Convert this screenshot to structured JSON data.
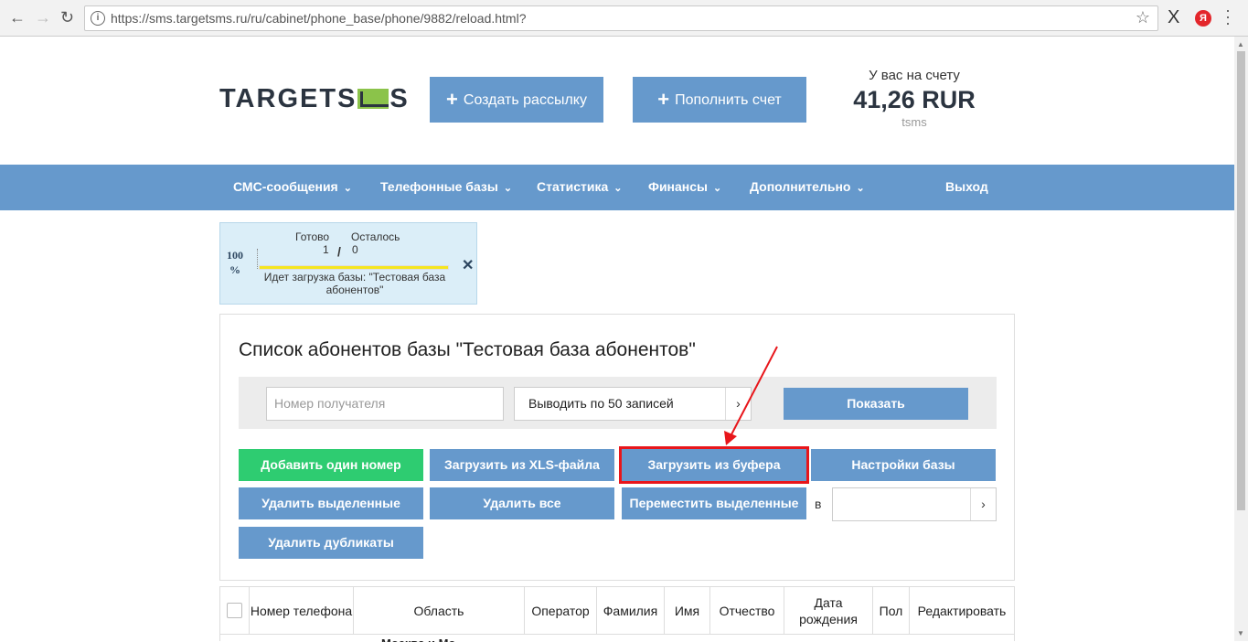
{
  "browser": {
    "url": "https://sms.targetsms.ru/ru/cabinet/phone_base/phone/9882/reload.html?",
    "ext_x": "X",
    "ext_ya": "Я"
  },
  "header": {
    "logo_left": "TARGETS",
    "logo_right": "S",
    "create_label": "Создать рассылку",
    "topup_label": "Пополнить счет",
    "balance_label": "У вас на счету",
    "balance_amount": "41,26 RUR",
    "balance_account": "tsms"
  },
  "nav": {
    "items": [
      {
        "label": "СМС-сообщения"
      },
      {
        "label": "Телефонные базы"
      },
      {
        "label": "Статистика"
      },
      {
        "label": "Финансы"
      },
      {
        "label": "Дополнительно"
      }
    ],
    "logout": "Выход"
  },
  "progress": {
    "percent_text": "100",
    "percent_sign": "%",
    "done_label": "Готово",
    "left_label": "Осталось",
    "done_value": "1",
    "left_value": "0",
    "percent": 100,
    "message": "Идет загрузка базы: \"Тестовая база абонентов\""
  },
  "main": {
    "title": "Список абонентов базы \"Тестовая база абонентов\"",
    "phone_placeholder": "Номер получателя",
    "per_page": "Выводить по 50 записей",
    "show_label": "Показать",
    "buttons": {
      "add_one": "Добавить один номер",
      "load_xls": "Загрузить из XLS-файла",
      "load_buffer": "Загрузить из буфера",
      "base_settings": "Настройки базы",
      "delete_selected": "Удалить выделенные",
      "delete_all": "Удалить все",
      "move_selected": "Переместить выделенные",
      "delete_duplicates": "Удалить дубликаты"
    },
    "in_label": "в",
    "highlight_color": "#e8161b"
  },
  "table": {
    "headers": [
      "Номер телефона",
      "Область",
      "Оператор",
      "Фамилия",
      "Имя",
      "Отчество",
      "Дата рождения",
      "Пол",
      "Редактировать"
    ],
    "peek_text": "Москва и Мо"
  },
  "colors": {
    "accent": "#6699cc",
    "success": "#2ecc71",
    "dark": "#2b3440"
  }
}
